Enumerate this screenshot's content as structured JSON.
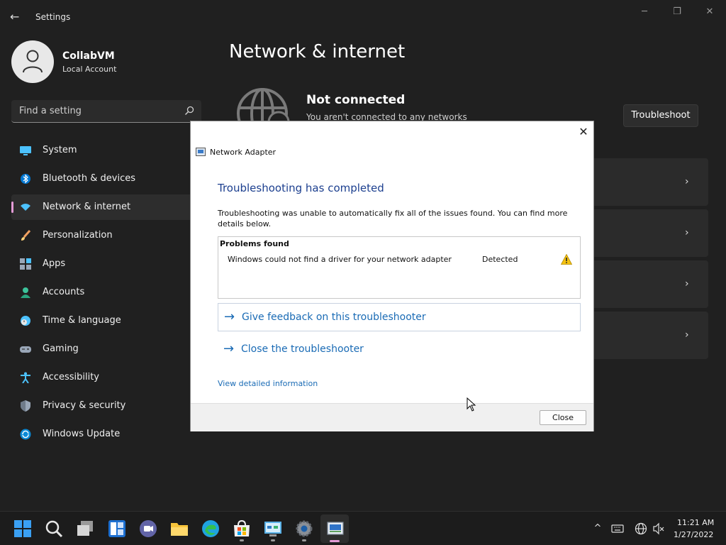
{
  "window": {
    "title": "Settings",
    "back_icon": "←",
    "minimize_icon": "─",
    "maximize_icon": "❐",
    "close_icon": "✕"
  },
  "profile": {
    "name": "CollabVM",
    "account_type": "Local Account"
  },
  "search": {
    "placeholder": "Find a setting"
  },
  "sidebar": {
    "items": [
      {
        "label": "System",
        "icon": "system-icon",
        "active": false
      },
      {
        "label": "Bluetooth & devices",
        "icon": "bluetooth-icon",
        "active": false
      },
      {
        "label": "Network & internet",
        "icon": "wifi-icon",
        "active": true
      },
      {
        "label": "Personalization",
        "icon": "brush-icon",
        "active": false
      },
      {
        "label": "Apps",
        "icon": "apps-icon",
        "active": false
      },
      {
        "label": "Accounts",
        "icon": "person-icon",
        "active": false
      },
      {
        "label": "Time & language",
        "icon": "clock-globe-icon",
        "active": false
      },
      {
        "label": "Gaming",
        "icon": "gamepad-icon",
        "active": false
      },
      {
        "label": "Accessibility",
        "icon": "accessibility-icon",
        "active": false
      },
      {
        "label": "Privacy & security",
        "icon": "shield-icon",
        "active": false
      },
      {
        "label": "Windows Update",
        "icon": "update-icon",
        "active": false
      }
    ]
  },
  "main": {
    "title": "Network & internet",
    "status_title": "Not connected",
    "status_subtitle": "You aren't connected to any networks",
    "troubleshoot_label": "Troubleshoot",
    "chevron": "›"
  },
  "dialog": {
    "app_name": "Network Adapter",
    "close_x": "✕",
    "heading": "Troubleshooting has completed",
    "description": "Troubleshooting was unable to automatically fix all of the issues found. You can find more details below.",
    "problems_header": "Problems found",
    "problems": [
      {
        "text": "Windows could not find a driver for your network adapter",
        "status": "Detected"
      }
    ],
    "links": [
      {
        "arrow": "→",
        "label": "Give feedback on this troubleshooter"
      },
      {
        "arrow": "→",
        "label": "Close the troubleshooter"
      }
    ],
    "detail_link": "View detailed information",
    "close_button": "Close"
  },
  "taskbar": {
    "apps": [
      "start-icon",
      "search-icon",
      "task-view-icon",
      "widgets-icon",
      "teams-chat-icon",
      "file-explorer-icon",
      "edge-icon",
      "store-icon",
      "control-panel-icon",
      "settings-icon",
      "network-adapter-icon"
    ],
    "tray": {
      "chevron": "^"
    },
    "time": "11:21 AM",
    "date": "1/27/2022"
  },
  "colors": {
    "accent": "#e49bd6",
    "link": "#1a6bb5",
    "dialog_heading": "#1c3f8f",
    "background": "#202020"
  }
}
